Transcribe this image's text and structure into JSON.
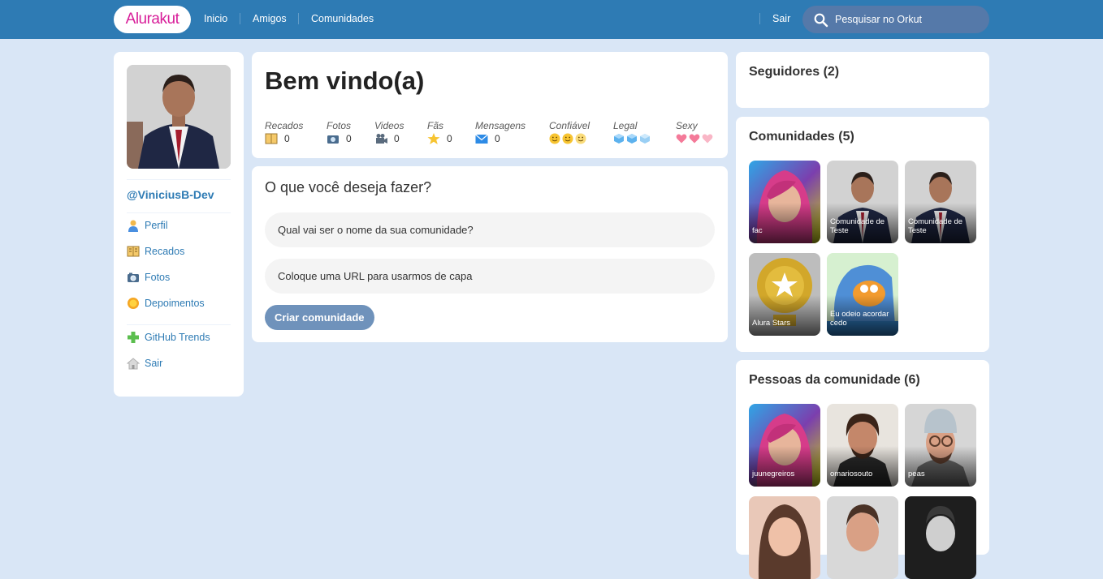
{
  "topbar": {
    "logo": "Alurakut",
    "nav": [
      "Inicio",
      "Amigos",
      "Comunidades"
    ],
    "logout": "Sair",
    "search_placeholder": "Pesquisar no Orkut"
  },
  "profile": {
    "username": "@ViniciusB-Dev",
    "menu": [
      {
        "label": "Perfil",
        "icon": "user-icon"
      },
      {
        "label": "Recados",
        "icon": "book-icon"
      },
      {
        "label": "Fotos",
        "icon": "camera-icon"
      },
      {
        "label": "Depoimentos",
        "icon": "sun-icon"
      },
      {
        "label": "GitHub Trends",
        "icon": "plus-icon"
      },
      {
        "label": "Sair",
        "icon": "logout-icon"
      }
    ]
  },
  "welcome": {
    "title": "Bem vindo(a)",
    "stats": [
      {
        "label": "Recados",
        "value": "0",
        "icon": "book-icon"
      },
      {
        "label": "Fotos",
        "value": "0",
        "icon": "camera-icon"
      },
      {
        "label": "Videos",
        "value": "0",
        "icon": "video-camera-icon"
      },
      {
        "label": "Fãs",
        "value": "0",
        "icon": "star-icon"
      },
      {
        "label": "Mensagens",
        "value": "0",
        "icon": "envelope-icon"
      }
    ],
    "ratings": [
      {
        "label": "Confiável",
        "icon": "smiley-icon",
        "level": 3
      },
      {
        "label": "Legal",
        "icon": "ice-cube-icon",
        "level": 3
      },
      {
        "label": "Sexy",
        "icon": "heart-icon",
        "level": 3
      }
    ]
  },
  "form": {
    "title": "O que você deseja fazer?",
    "name_placeholder": "Qual vai ser o nome da sua comunidade?",
    "image_placeholder": "Coloque uma URL para usarmos de capa",
    "submit_label": "Criar comunidade"
  },
  "followers": {
    "title": "Seguidores (2)"
  },
  "communities": {
    "title": "Comunidades (5)",
    "items": [
      "fac",
      "Comunidade de Teste",
      "Comunidade de Teste",
      "Alura Stars",
      "Eu odeio acordar cedo"
    ]
  },
  "people": {
    "title": "Pessoas da comunidade (6)",
    "items": [
      "juunegreiros",
      "omariosouto",
      "peas",
      "",
      "",
      ""
    ]
  },
  "colors": {
    "topbar": "#2E7BB4",
    "background": "#D9E6F6",
    "logo_text": "#D81D99",
    "link": "#2E7BB4",
    "button": "#6F92BB"
  }
}
